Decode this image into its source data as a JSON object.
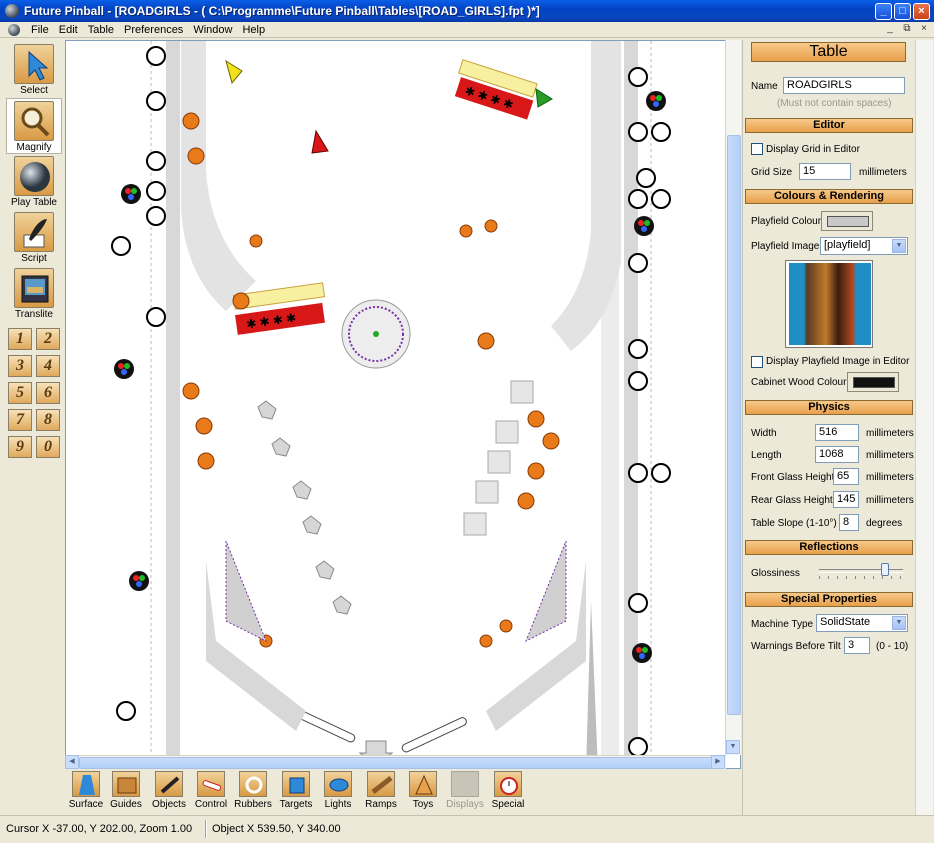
{
  "window": {
    "title": "Future Pinball - [ROADGIRLS - ( C:\\Programme\\Future Pinball\\Tables\\[ROAD_GIRLS].fpt )*]",
    "minimize": "_",
    "maximize": "□",
    "close": "×"
  },
  "menu": {
    "items": [
      "File",
      "Edit",
      "Table",
      "Preferences",
      "Window",
      "Help"
    ],
    "mdi_minimize": "_",
    "mdi_restore": "⧉",
    "mdi_close": "×"
  },
  "left_toolbar": {
    "tools": [
      "Select",
      "Magnify",
      "Play Table",
      "Script",
      "Translite"
    ],
    "numbers": [
      "1",
      "2",
      "3",
      "4",
      "5",
      "6",
      "7",
      "8",
      "9",
      "0"
    ]
  },
  "bottom_toolbar": {
    "tools": [
      "Surface",
      "Guides",
      "Objects",
      "Control",
      "Rubbers",
      "Targets",
      "Lights",
      "Ramps",
      "Toys",
      "Displays",
      "Special"
    ]
  },
  "panel": {
    "title": "Table",
    "name_label": "Name",
    "name_value": "ROADGIRLS",
    "name_hint": "(Must not contain spaces)",
    "editor": {
      "header": "Editor",
      "display_grid": "Display Grid in Editor",
      "grid_size_label": "Grid Size",
      "grid_size_value": "15",
      "grid_size_unit": "millimeters"
    },
    "colours": {
      "header": "Colours & Rendering",
      "playfield_colour": "Playfield Colour",
      "playfield_colour_hex": "#c8c8c8",
      "playfield_image": "Playfield Image",
      "playfield_image_value": "[playfield]",
      "display_playfield_image": "Display Playfield Image in Editor",
      "cabinet_wood_colour": "Cabinet Wood Colour",
      "cabinet_wood_colour_hex": "#111111"
    },
    "physics": {
      "header": "Physics",
      "width_label": "Width",
      "width_value": "516",
      "width_unit": "millimeters",
      "length_label": "Length",
      "length_value": "1068",
      "length_unit": "millimeters",
      "front_glass_label": "Front Glass Height",
      "front_glass_value": "65",
      "front_glass_unit": "millimeters",
      "rear_glass_label": "Rear Glass Height",
      "rear_glass_value": "145",
      "rear_glass_unit": "millimeters",
      "slope_label": "Table Slope (1-10°)",
      "slope_value": "8",
      "slope_unit": "degrees"
    },
    "reflections": {
      "header": "Reflections",
      "glossiness_label": "Glossiness",
      "glossiness_level": 0.8
    },
    "special": {
      "header": "Special Properties",
      "machine_type_label": "Machine Type",
      "machine_type_value": "SolidState",
      "warnings_label": "Warnings Before Tilt",
      "warnings_value": "3",
      "warnings_range": "(0 - 10)"
    }
  },
  "status": {
    "cursor": "Cursor X -37.00, Y 202.00, Zoom 1.00",
    "object": "Object X 539.50, Y 340.00"
  },
  "colors": {
    "accent": "#e8a04c",
    "title_bar": "#0a46c0",
    "playfield": "#ffffff",
    "inlane_gray": "#d8d8d8",
    "bumper_orange": "#e87a1a",
    "target_red": "#d81818"
  }
}
